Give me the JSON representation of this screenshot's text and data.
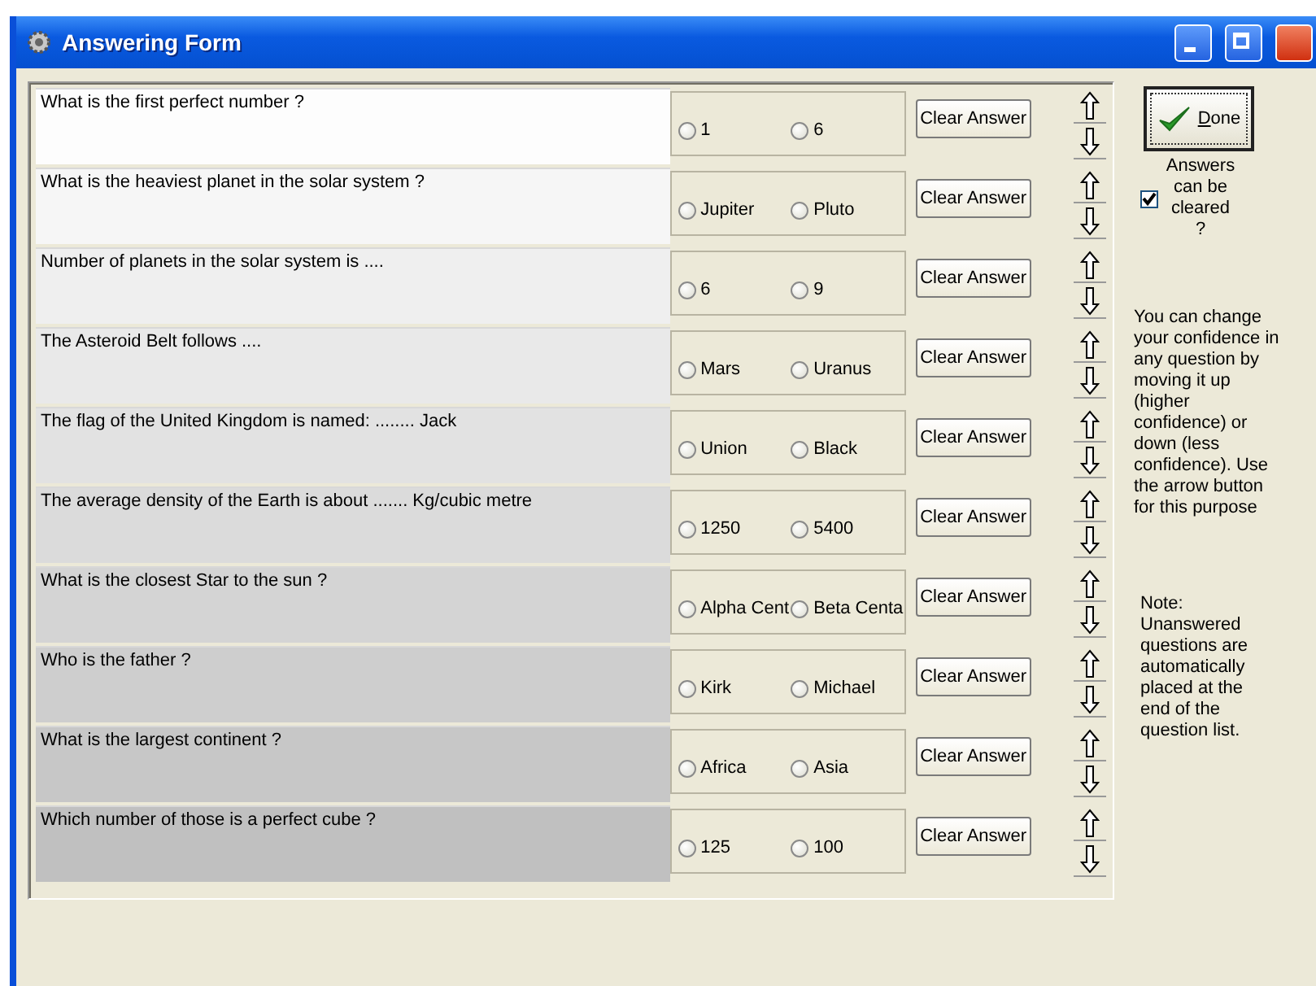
{
  "window": {
    "title": "Answering Form"
  },
  "questions": [
    {
      "text": "What is the first perfect number ?",
      "options": [
        {
          "label": "1",
          "selected": false
        },
        {
          "label": "6",
          "selected": false
        }
      ],
      "clear_button": "Clear Answer"
    },
    {
      "text": "What is the heaviest planet in the solar system ?",
      "options": [
        {
          "label": "Jupiter",
          "selected": false
        },
        {
          "label": "Pluto",
          "selected": false
        }
      ],
      "clear_button": "Clear Answer"
    },
    {
      "text": "Number of planets in the solar system is ....",
      "options": [
        {
          "label": "6",
          "selected": false
        },
        {
          "label": "9",
          "selected": false
        }
      ],
      "clear_button": "Clear Answer"
    },
    {
      "text": "The Asteroid Belt follows ....",
      "options": [
        {
          "label": "Mars",
          "selected": false
        },
        {
          "label": "Uranus",
          "selected": false
        }
      ],
      "clear_button": "Clear Answer"
    },
    {
      "text": "The flag of the United Kingdom is named: ........ Jack",
      "options": [
        {
          "label": "Union",
          "selected": false
        },
        {
          "label": "Black",
          "selected": false
        }
      ],
      "clear_button": "Clear Answer"
    },
    {
      "text": "The average density of the Earth is about ....... Kg/cubic metre",
      "options": [
        {
          "label": "1250",
          "selected": false
        },
        {
          "label": "5400",
          "selected": false
        }
      ],
      "clear_button": "Clear Answer"
    },
    {
      "text": "What is the closest Star to the sun ?",
      "options": [
        {
          "label": "Alpha Cent",
          "selected": false
        },
        {
          "label": "Beta Centa",
          "selected": false
        }
      ],
      "clear_button": "Clear Answer"
    },
    {
      "text": "Who is the father ?",
      "options": [
        {
          "label": "Kirk",
          "selected": false
        },
        {
          "label": "Michael",
          "selected": false
        }
      ],
      "clear_button": "Clear Answer"
    },
    {
      "text": "What is the largest continent ?",
      "options": [
        {
          "label": "Africa",
          "selected": false
        },
        {
          "label": "Asia",
          "selected": false
        }
      ],
      "clear_button": "Clear Answer"
    },
    {
      "text": "Which number of those is a perfect cube ?",
      "options": [
        {
          "label": "125",
          "selected": false
        },
        {
          "label": "100",
          "selected": false
        }
      ],
      "clear_button": "Clear Answer"
    }
  ],
  "side": {
    "done_button": "Done",
    "clearable": {
      "label": "Answers can be cleared ?",
      "checked": true
    },
    "help": "You can change your confidence in any question by moving it up (higher confidence) or down (less confidence). Use the arrow button for this purpose",
    "note": "Note: Unanswered questions are automatically placed at the end of the question list."
  }
}
